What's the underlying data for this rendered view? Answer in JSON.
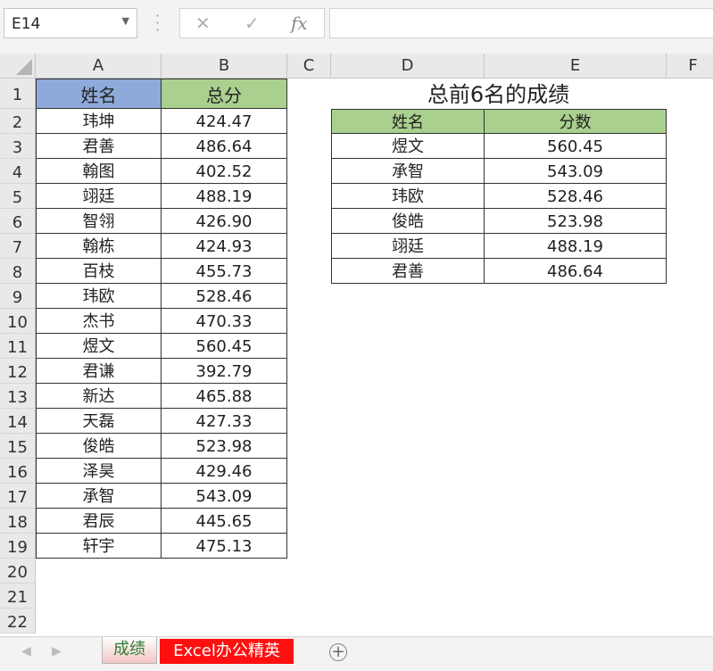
{
  "formula_bar": {
    "name_box": "E14",
    "cancel_icon": "✕",
    "enter_icon": "✓",
    "fx_label": "fx",
    "formula": ""
  },
  "columns": [
    "A",
    "B",
    "C",
    "D",
    "E",
    "F"
  ],
  "rows": [
    "1",
    "2",
    "3",
    "4",
    "5",
    "6",
    "7",
    "8",
    "9",
    "10",
    "11",
    "12",
    "13",
    "14",
    "15",
    "16",
    "17",
    "18",
    "19",
    "20",
    "21",
    "22"
  ],
  "table1": {
    "headers": [
      "姓名",
      "总分"
    ],
    "header_colors": [
      "#8eaadb",
      "#a9d08e"
    ],
    "rows": [
      [
        "玮坤",
        "424.47"
      ],
      [
        "君善",
        "486.64"
      ],
      [
        "翰图",
        "402.52"
      ],
      [
        "翊廷",
        "488.19"
      ],
      [
        "智翎",
        "426.90"
      ],
      [
        "翰栋",
        "424.93"
      ],
      [
        "百枝",
        "455.73"
      ],
      [
        "玮欧",
        "528.46"
      ],
      [
        "杰书",
        "470.33"
      ],
      [
        "煜文",
        "560.45"
      ],
      [
        "君谦",
        "392.79"
      ],
      [
        "新达",
        "465.88"
      ],
      [
        "天磊",
        "427.33"
      ],
      [
        "俊皓",
        "523.98"
      ],
      [
        "泽昊",
        "429.46"
      ],
      [
        "承智",
        "543.09"
      ],
      [
        "君辰",
        "445.65"
      ],
      [
        "轩宇",
        "475.13"
      ]
    ]
  },
  "table2": {
    "title": "总前6名的成绩",
    "headers": [
      "姓名",
      "分数"
    ],
    "header_color": "#a9d08e",
    "rows": [
      [
        "煜文",
        "560.45"
      ],
      [
        "承智",
        "543.09"
      ],
      [
        "玮欧",
        "528.46"
      ],
      [
        "俊皓",
        "523.98"
      ],
      [
        "翊廷",
        "488.19"
      ],
      [
        "君善",
        "486.64"
      ]
    ]
  },
  "sheets": [
    {
      "label": "成绩",
      "active": true
    },
    {
      "label": "Excel办公精英",
      "color": "#ff1010"
    }
  ]
}
